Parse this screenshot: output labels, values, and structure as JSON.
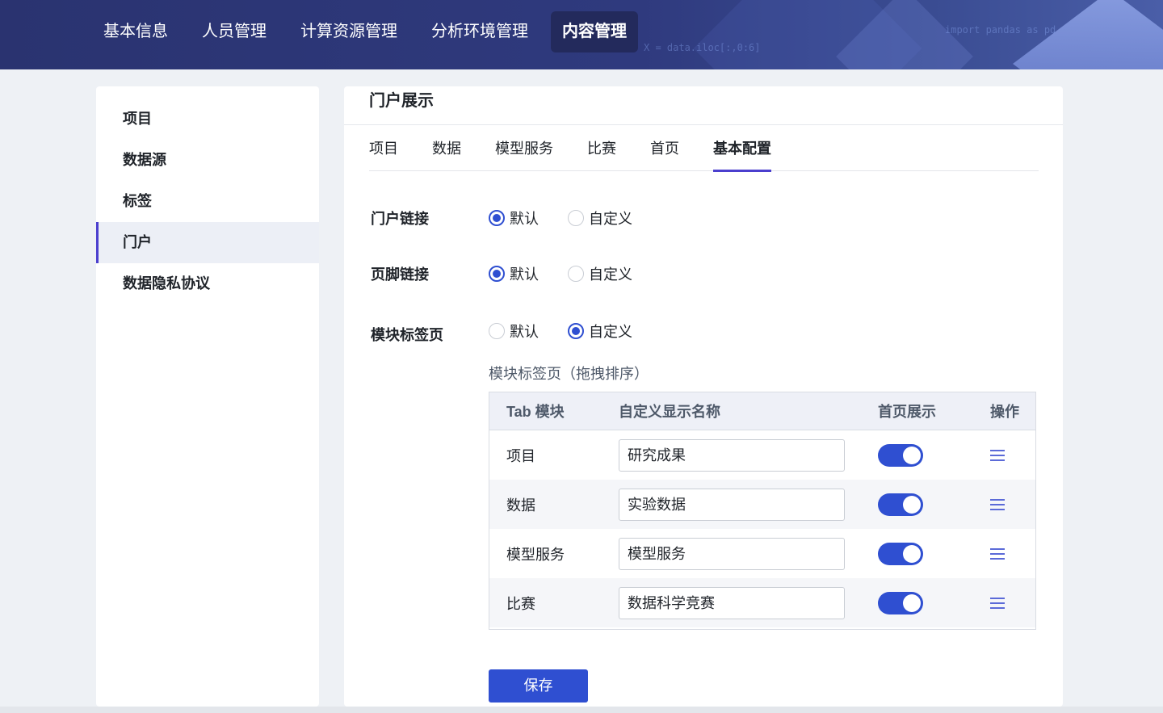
{
  "nav": {
    "items": [
      {
        "label": "基本信息"
      },
      {
        "label": "人员管理"
      },
      {
        "label": "计算资源管理"
      },
      {
        "label": "分析环境管理"
      },
      {
        "label": "内容管理"
      }
    ],
    "code_snippets": [
      "import pandas as pd",
      "X = data.iloc[:,0:6]"
    ]
  },
  "sidebar": {
    "items": [
      {
        "label": "项目"
      },
      {
        "label": "数据源"
      },
      {
        "label": "标签"
      },
      {
        "label": "门户"
      },
      {
        "label": "数据隐私协议"
      }
    ]
  },
  "main": {
    "title": "门户展示",
    "tabs": [
      {
        "label": "项目"
      },
      {
        "label": "数据"
      },
      {
        "label": "模型服务"
      },
      {
        "label": "比赛"
      },
      {
        "label": "首页"
      },
      {
        "label": "基本配置"
      }
    ],
    "form": {
      "portal_link": {
        "label": "门户链接",
        "opt_default": "默认",
        "opt_custom": "自定义",
        "selected": "默认"
      },
      "footer_link": {
        "label": "页脚链接",
        "opt_default": "默认",
        "opt_custom": "自定义",
        "selected": "默认"
      },
      "module_tabs": {
        "label": "模块标签页",
        "opt_default": "默认",
        "opt_custom": "自定义",
        "selected": "自定义"
      }
    },
    "module_table": {
      "subtitle": "模块标签页（拖拽排序）",
      "headers": {
        "module": "Tab 模块",
        "display_name": "自定义显示名称",
        "home_show": "首页展示",
        "action": "操作"
      },
      "rows": [
        {
          "module": "项目",
          "display_name": "研究成果",
          "home_show": true
        },
        {
          "module": "数据",
          "display_name": "实验数据",
          "home_show": true
        },
        {
          "module": "模型服务",
          "display_name": "模型服务",
          "home_show": true
        },
        {
          "module": "比赛",
          "display_name": "数据科学竞赛",
          "home_show": true
        }
      ]
    },
    "save_label": "保存"
  },
  "colors": {
    "accent": "#2f4fd1",
    "nav_bg": "#2f3a7e",
    "active_indicator": "#4b3fce"
  }
}
